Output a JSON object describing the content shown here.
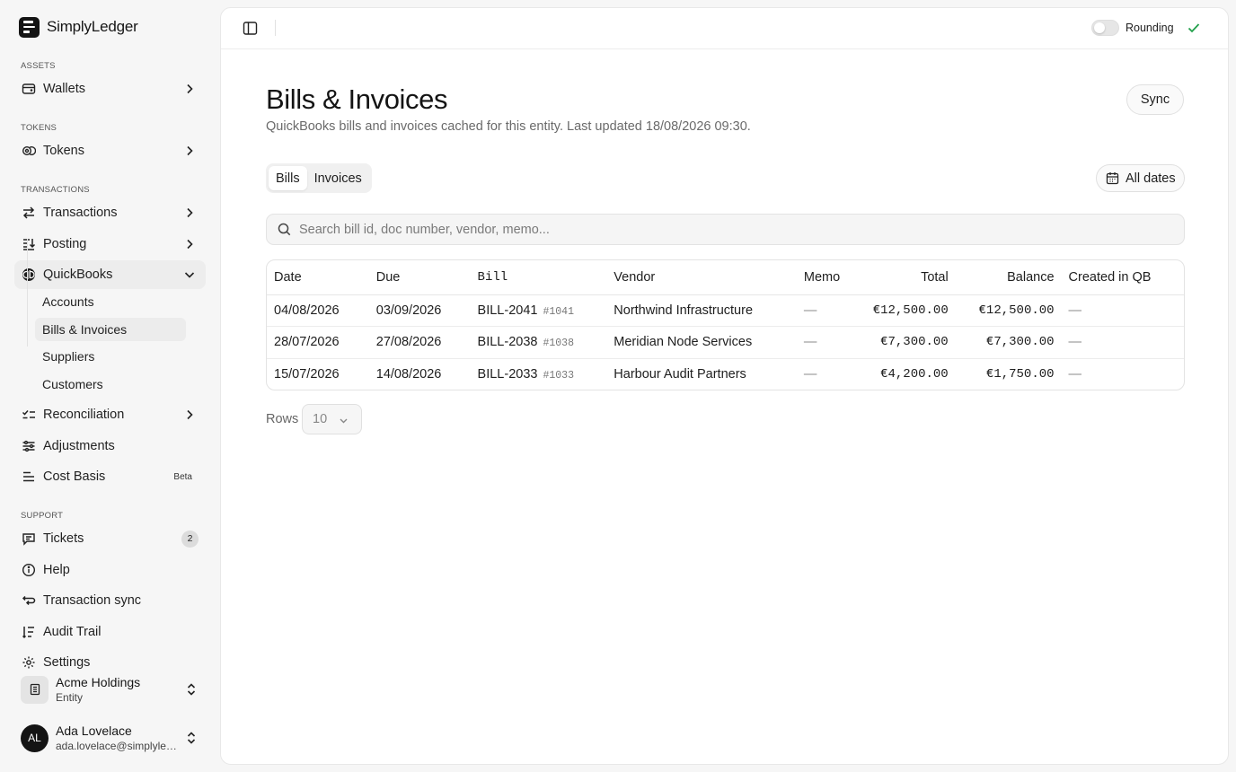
{
  "brand": {
    "name": "SimplyLedger"
  },
  "sidebar": {
    "sections": {
      "assets": "ASSETS",
      "tokens": "TOKENS",
      "transactions": "TRANSACTIONS",
      "support": "SUPPORT"
    },
    "items": {
      "wallets": "Wallets",
      "tokens": "Tokens",
      "transactions": "Transactions",
      "posting": "Posting",
      "quickbooks": "QuickBooks",
      "reconciliation": "Reconciliation",
      "adjustments": "Adjustments",
      "cost_basis": "Cost Basis",
      "cost_basis_badge": "Beta",
      "tickets": "Tickets",
      "tickets_count": "2",
      "help": "Help",
      "transaction_sync": "Transaction sync",
      "audit_trail": "Audit Trail",
      "settings": "Settings"
    },
    "quickbooks_sub": {
      "accounts": "Accounts",
      "bills_invoices": "Bills & Invoices",
      "suppliers": "Suppliers",
      "customers": "Customers"
    },
    "entity": {
      "name": "Acme Holdings",
      "type": "Entity"
    },
    "user": {
      "initials": "AL",
      "name": "Ada Lovelace",
      "email": "ada.lovelace@simplyledger.com"
    }
  },
  "topbar": {
    "rounding_label": "Rounding",
    "rounding_on": false
  },
  "page": {
    "title": "Bills & Invoices",
    "subtitle": "QuickBooks bills and invoices cached for this entity. Last updated 18/08/2026 09:30.",
    "sync_label": "Sync",
    "tabs": {
      "bills": "Bills",
      "invoices": "Invoices",
      "active": "Bills"
    },
    "date_filter": "All dates",
    "search_placeholder": "Search bill id, doc number, vendor, memo..."
  },
  "table": {
    "headers": {
      "date": "Date",
      "due": "Due",
      "bill": "Bill",
      "vendor": "Vendor",
      "memo": "Memo",
      "total": "Total",
      "balance": "Balance",
      "created": "Created in QB"
    },
    "rows": [
      {
        "date": "04/08/2026",
        "due": "03/09/2026",
        "bill": "BILL-2041",
        "doc": "#1041",
        "vendor": "Northwind Infrastructure",
        "memo": "—",
        "total": "€12,500.00",
        "balance": "€12,500.00",
        "created": "—"
      },
      {
        "date": "28/07/2026",
        "due": "27/08/2026",
        "bill": "BILL-2038",
        "doc": "#1038",
        "vendor": "Meridian Node Services",
        "memo": "—",
        "total": "€7,300.00",
        "balance": "€7,300.00",
        "created": "—"
      },
      {
        "date": "15/07/2026",
        "due": "14/08/2026",
        "bill": "BILL-2033",
        "doc": "#1033",
        "vendor": "Harbour Audit Partners",
        "memo": "—",
        "total": "€4,200.00",
        "balance": "€1,750.00",
        "created": "—"
      }
    ]
  },
  "pagination": {
    "rows_label": "Rows",
    "rows_value": "10"
  },
  "colors": {
    "accent_check": "#22a04b",
    "sidebar_bg": "#f6f6f6"
  }
}
